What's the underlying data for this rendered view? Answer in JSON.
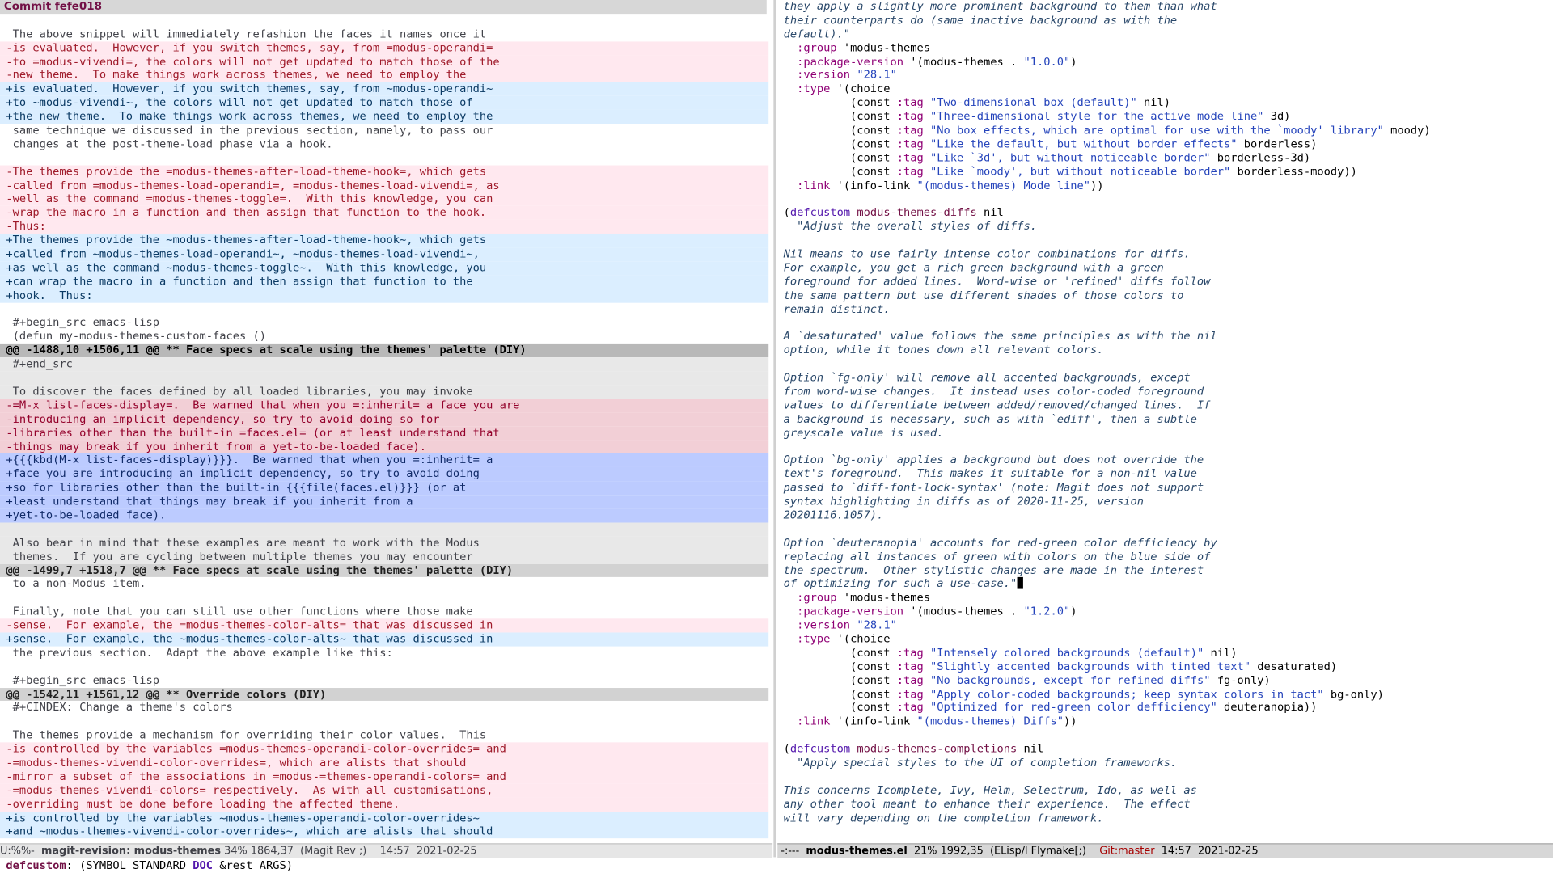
{
  "left_buffer": {
    "title": "Commit fefe018",
    "lines": [
      {
        "type": "ctx",
        "text": ""
      },
      {
        "type": "ctx",
        "text": " The above snippet will immediately refashion the faces it names once it"
      },
      {
        "type": "del",
        "text": "-is evaluated.  However, if you switch themes, say, from =modus-operandi="
      },
      {
        "type": "del",
        "text": "-to =modus-vivendi=, the colors will not get updated to match those of the"
      },
      {
        "type": "del",
        "text": "-new theme.  To make things work across themes, we need to employ the"
      },
      {
        "type": "add",
        "text": "+is evaluated.  However, if you switch themes, say, from ~modus-operandi~"
      },
      {
        "type": "add",
        "text": "+to ~modus-vivendi~, the colors will not get updated to match those of"
      },
      {
        "type": "add",
        "text": "+the new theme.  To make things work across themes, we need to employ the"
      },
      {
        "type": "ctx",
        "text": " same technique we discussed in the previous section, namely, to pass our"
      },
      {
        "type": "ctx",
        "text": " changes at the post-theme-load phase via a hook."
      },
      {
        "type": "ctx",
        "text": ""
      },
      {
        "type": "del",
        "text": "-The themes provide the =modus-themes-after-load-theme-hook=, which gets"
      },
      {
        "type": "del",
        "text": "-called from =modus-themes-load-operandi=, =modus-themes-load-vivendi=, as"
      },
      {
        "type": "del",
        "text": "-well as the command =modus-themes-toggle=.  With this knowledge, you can"
      },
      {
        "type": "del",
        "text": "-wrap the macro in a function and then assign that function to the hook."
      },
      {
        "type": "del",
        "text": "-Thus:"
      },
      {
        "type": "add",
        "text": "+The themes provide the ~modus-themes-after-load-theme-hook~, which gets"
      },
      {
        "type": "add",
        "text": "+called from ~modus-themes-load-operandi~, ~modus-themes-load-vivendi~,"
      },
      {
        "type": "add",
        "text": "+as well as the command ~modus-themes-toggle~.  With this knowledge, you"
      },
      {
        "type": "add",
        "text": "+can wrap the macro in a function and then assign that function to the"
      },
      {
        "type": "add",
        "text": "+hook.  Thus:"
      },
      {
        "type": "ctx",
        "text": ""
      },
      {
        "type": "ctx",
        "text": " #+begin_src emacs-lisp"
      },
      {
        "type": "ctx",
        "text": " (defun my-modus-themes-custom-faces ()"
      },
      {
        "type": "hunk",
        "text": "@@ -1488,10 +1506,11 @@ ** Face specs at scale using the themes' palette (DIY)"
      },
      {
        "type": "ctx-hl",
        "text": " #+end_src"
      },
      {
        "type": "ctx-hl",
        "text": ""
      },
      {
        "type": "ctx-hl",
        "text": " To discover the faces defined by all loaded libraries, you may invoke"
      },
      {
        "type": "del-hl",
        "text": "-=M-x list-faces-display=.  Be warned that when you =:inherit= a face you are"
      },
      {
        "type": "del-hl",
        "text": "-introducing an implicit dependency, so try to avoid doing so for"
      },
      {
        "type": "del-hl",
        "text": "-libraries other than the built-in =faces.el= (or at least understand that"
      },
      {
        "type": "del-hl",
        "text": "-things may break if you inherit from a yet-to-be-loaded face)."
      },
      {
        "type": "add-hl",
        "text": "+{{{kbd(M-x list-faces-display)}}}.  Be warned that when you =:inherit= a"
      },
      {
        "type": "add-hl",
        "text": "+face you are introducing an implicit dependency, so try to avoid doing"
      },
      {
        "type": "add-hl",
        "text": "+so for libraries other than the built-in {{{file(faces.el)}}} (or at"
      },
      {
        "type": "add-hl",
        "text": "+least understand that things may break if you inherit from a"
      },
      {
        "type": "add-hl",
        "text": "+yet-to-be-loaded face)."
      },
      {
        "type": "ctx-hl",
        "text": ""
      },
      {
        "type": "ctx-hl",
        "text": " Also bear in mind that these examples are meant to work with the Modus"
      },
      {
        "type": "ctx-hl",
        "text": " themes.  If you are cycling between multiple themes you may encounter"
      },
      {
        "type": "hunk-dim",
        "text": "@@ -1499,7 +1518,7 @@ ** Face specs at scale using the themes' palette (DIY)"
      },
      {
        "type": "ctx",
        "text": " to a non-Modus item."
      },
      {
        "type": "ctx",
        "text": ""
      },
      {
        "type": "ctx",
        "text": " Finally, note that you can still use other functions where those make"
      },
      {
        "type": "del",
        "text": "-sense.  For example, the =modus-themes-color-alts= that was discussed in"
      },
      {
        "type": "add",
        "text": "+sense.  For example, the ~modus-themes-color-alts~ that was discussed in"
      },
      {
        "type": "ctx",
        "text": " the previous section.  Adapt the above example like this:"
      },
      {
        "type": "ctx",
        "text": ""
      },
      {
        "type": "ctx",
        "text": " #+begin_src emacs-lisp"
      },
      {
        "type": "hunk-dim",
        "text": "@@ -1542,11 +1561,12 @@ ** Override colors (DIY)"
      },
      {
        "type": "ctx",
        "text": " #+CINDEX: Change a theme's colors"
      },
      {
        "type": "ctx",
        "text": ""
      },
      {
        "type": "ctx",
        "text": " The themes provide a mechanism for overriding their color values.  This"
      },
      {
        "type": "del",
        "text": "-is controlled by the variables =modus-themes-operandi-color-overrides= and"
      },
      {
        "type": "del",
        "text": "-=modus-themes-vivendi-color-overrides=, which are alists that should"
      },
      {
        "type": "del",
        "text": "-mirror a subset of the associations in =modus-=themes-operandi-colors= and"
      },
      {
        "type": "del",
        "text": "-=modus-themes-vivendi-colors= respectively.  As with all customisations,"
      },
      {
        "type": "del",
        "text": "-overriding must be done before loading the affected theme."
      },
      {
        "type": "add",
        "text": "+is controlled by the variables ~modus-themes-operandi-color-overrides~"
      },
      {
        "type": "add",
        "text": "+and ~modus-themes-vivendi-color-overrides~, which are alists that should"
      }
    ],
    "modeline": {
      "state": "U:%%-  ",
      "buffer": "magit-revision: modus-themes",
      "rest": " 34% 1864,37  (Magit Rev ;)    14:57  2021-02-25"
    }
  },
  "right_buffer": {
    "lines": [
      {
        "t": "doc",
        "text": "they apply a slightly more prominent background to them than what"
      },
      {
        "t": "doc",
        "text": "their counterparts do (same inactive background as with the"
      },
      {
        "t": "doc",
        "text": "default).\""
      },
      {
        "t": "kv",
        "key": "  :group",
        "val": " 'modus-themes"
      },
      {
        "t": "kv",
        "key": "  :package-version",
        "val": " '(modus-themes . ",
        "str": "\"1.0.0\"",
        "tail": ")"
      },
      {
        "t": "kv",
        "key": "  :version",
        "val": " ",
        "str": "\"28.1\"",
        "tail": ""
      },
      {
        "t": "kv",
        "key": "  :type",
        "val": " '(choice",
        "tail": ""
      },
      {
        "t": "const",
        "lead": "          (const ",
        "key": ":tag",
        "str": " \"Two-dimensional box (default)\"",
        "tail": " nil)"
      },
      {
        "t": "const",
        "lead": "          (const ",
        "key": ":tag",
        "str": " \"Three-dimensional style for the active mode line\"",
        "tail": " 3d)"
      },
      {
        "t": "const",
        "lead": "          (const ",
        "key": ":tag",
        "str": " \"No box effects, which are optimal for use with the `moody' library\"",
        "tail": " moody)"
      },
      {
        "t": "const",
        "lead": "          (const ",
        "key": ":tag",
        "str": " \"Like the default, but without border effects\"",
        "tail": " borderless)"
      },
      {
        "t": "const",
        "lead": "          (const ",
        "key": ":tag",
        "str": " \"Like `3d', but without noticeable border\"",
        "tail": " borderless-3d)"
      },
      {
        "t": "const",
        "lead": "          (const ",
        "key": ":tag",
        "str": " \"Like `moody', but without noticeable border\"",
        "tail": " borderless-moody))"
      },
      {
        "t": "kv",
        "key": "  :link",
        "val": " '(info-link ",
        "str": "\"(modus-themes) Mode line\"",
        "tail": "))"
      },
      {
        "t": "plain",
        "text": ""
      },
      {
        "t": "def",
        "lead": "(",
        "kw": "defcustom",
        "name": " modus-themes-diffs",
        "tail": " nil"
      },
      {
        "t": "doc",
        "text": "  \"Adjust the overall styles of diffs."
      },
      {
        "t": "doc",
        "text": ""
      },
      {
        "t": "doc",
        "text": "Nil means to use fairly intense color combinations for diffs."
      },
      {
        "t": "doc",
        "text": "For example, you get a rich green background with a green"
      },
      {
        "t": "doc",
        "text": "foreground for added lines.  Word-wise or 'refined' diffs follow"
      },
      {
        "t": "doc",
        "text": "the same pattern but use different shades of those colors to"
      },
      {
        "t": "doc",
        "text": "remain distinct."
      },
      {
        "t": "doc",
        "text": ""
      },
      {
        "t": "doc",
        "text": "A `desaturated' value follows the same principles as with the nil"
      },
      {
        "t": "doc",
        "text": "option, while it tones down all relevant colors."
      },
      {
        "t": "doc",
        "text": ""
      },
      {
        "t": "doc",
        "text": "Option `fg-only' will remove all accented backgrounds, except"
      },
      {
        "t": "doc",
        "text": "from word-wise changes.  It instead uses color-coded foreground"
      },
      {
        "t": "doc",
        "text": "values to differentiate between added/removed/changed lines.  If"
      },
      {
        "t": "doc",
        "text": "a background is necessary, such as with `ediff', then a subtle"
      },
      {
        "t": "doc",
        "text": "greyscale value is used."
      },
      {
        "t": "doc",
        "text": ""
      },
      {
        "t": "doc",
        "text": "Option `bg-only' applies a background but does not override the"
      },
      {
        "t": "doc",
        "text": "text's foreground.  This makes it suitable for a non-nil value"
      },
      {
        "t": "doc",
        "text": "passed to `diff-font-lock-syntax' (note: Magit does not support"
      },
      {
        "t": "doc",
        "text": "syntax highlighting in diffs as of 2020-11-25, version"
      },
      {
        "t": "doc",
        "text": "20201116.1057)."
      },
      {
        "t": "doc",
        "text": ""
      },
      {
        "t": "doc",
        "text": "Option `deuteranopia' accounts for red-green color defficiency by"
      },
      {
        "t": "doc",
        "text": "replacing all instances of green with colors on the blue side of"
      },
      {
        "t": "doc",
        "text": "the spectrum.  Other stylistic changes are made in the interest"
      },
      {
        "t": "doccursor",
        "text": "of optimizing for such a use-case.\""
      },
      {
        "t": "kv",
        "key": "  :group",
        "val": " 'modus-themes"
      },
      {
        "t": "kv",
        "key": "  :package-version",
        "val": " '(modus-themes . ",
        "str": "\"1.2.0\"",
        "tail": ")"
      },
      {
        "t": "kv",
        "key": "  :version",
        "val": " ",
        "str": "\"28.1\"",
        "tail": ""
      },
      {
        "t": "kv",
        "key": "  :type",
        "val": " '(choice",
        "tail": ""
      },
      {
        "t": "const",
        "lead": "          (const ",
        "key": ":tag",
        "str": " \"Intensely colored backgrounds (default)\"",
        "tail": " nil)"
      },
      {
        "t": "const",
        "lead": "          (const ",
        "key": ":tag",
        "str": " \"Slightly accented backgrounds with tinted text\"",
        "tail": " desaturated)"
      },
      {
        "t": "const",
        "lead": "          (const ",
        "key": ":tag",
        "str": " \"No backgrounds, except for refined diffs\"",
        "tail": " fg-only)"
      },
      {
        "t": "const",
        "lead": "          (const ",
        "key": ":tag",
        "str": " \"Apply color-coded backgrounds; keep syntax colors in tact\"",
        "tail": " bg-only)"
      },
      {
        "t": "const",
        "lead": "          (const ",
        "key": ":tag",
        "str": " \"Optimized for red-green color defficiency\"",
        "tail": " deuteranopia))"
      },
      {
        "t": "kv",
        "key": "  :link",
        "val": " '(info-link ",
        "str": "\"(modus-themes) Diffs\"",
        "tail": "))"
      },
      {
        "t": "plain",
        "text": ""
      },
      {
        "t": "def",
        "lead": "(",
        "kw": "defcustom",
        "name": " modus-themes-completions",
        "tail": " nil"
      },
      {
        "t": "doc",
        "text": "  \"Apply special styles to the UI of completion frameworks."
      },
      {
        "t": "doc",
        "text": ""
      },
      {
        "t": "doc",
        "text": "This concerns Icomplete, Ivy, Helm, Selectrum, Ido, as well as"
      },
      {
        "t": "doc",
        "text": "any other tool meant to enhance their experience.  The effect"
      },
      {
        "t": "doc",
        "text": "will vary depending on the completion framework."
      },
      {
        "t": "doc",
        "text": ""
      }
    ],
    "modeline": {
      "state": " -:---  ",
      "buffer": "modus-themes.el",
      "rest": "  21% 1992,35  (ELisp/l Flymake[;)    ",
      "git": "Git:master",
      "time": "  14:57  2021-02-25"
    }
  },
  "echo_area": {
    "fn": "defcustom",
    "sig_a": ": (SYMBOL STANDARD ",
    "sig_doc": "DOC",
    "sig_b": " &rest ARGS)"
  },
  "colors": {
    "deleted_bg": "#ffe8ef",
    "added_bg": "#dbeeff",
    "hunk_bg": "#b8b8b8",
    "keyword": "#5317ac",
    "string": "#2544bb",
    "docstring": "#2a486a"
  }
}
